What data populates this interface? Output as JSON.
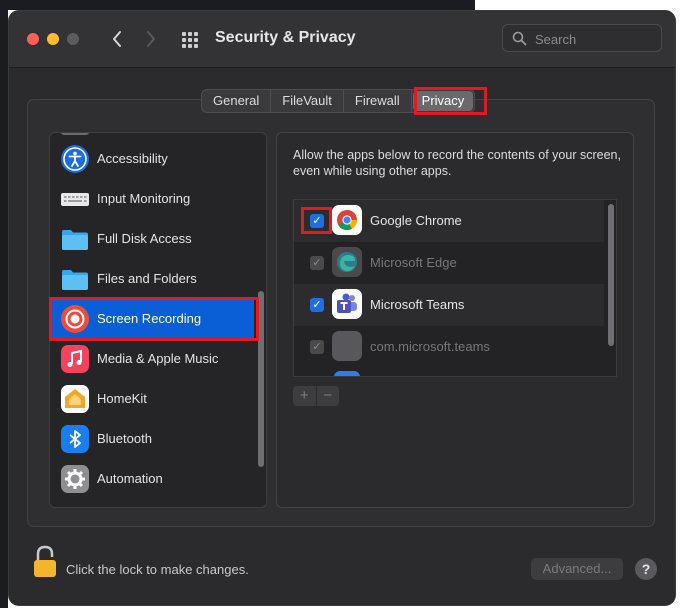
{
  "window": {
    "title": "Security & Privacy",
    "search_placeholder": "Search"
  },
  "tabs": [
    {
      "label": "General"
    },
    {
      "label": "FileVault"
    },
    {
      "label": "Firewall"
    },
    {
      "label": "Privacy",
      "active": true
    }
  ],
  "sidebar": {
    "items": [
      {
        "label": "Accessibility",
        "icon": "accessibility-icon"
      },
      {
        "label": "Input Monitoring",
        "icon": "keyboard-icon"
      },
      {
        "label": "Full Disk Access",
        "icon": "folder-icon"
      },
      {
        "label": "Files and Folders",
        "icon": "folder-icon"
      },
      {
        "label": "Screen Recording",
        "icon": "screen-recording-icon",
        "selected": true
      },
      {
        "label": "Media & Apple Music",
        "icon": "music-icon"
      },
      {
        "label": "HomeKit",
        "icon": "homekit-icon"
      },
      {
        "label": "Bluetooth",
        "icon": "bluetooth-icon"
      },
      {
        "label": "Automation",
        "icon": "gear-icon"
      }
    ]
  },
  "main": {
    "description": "Allow the apps below to record the contents of your screen, even while using other apps.",
    "apps": [
      {
        "name": "Google Chrome",
        "checked": true,
        "enabled": true,
        "icon": "chrome-icon"
      },
      {
        "name": "Microsoft Edge",
        "checked": true,
        "enabled": false,
        "icon": "edge-icon"
      },
      {
        "name": "Microsoft Teams",
        "checked": true,
        "enabled": true,
        "icon": "teams-icon"
      },
      {
        "name": "com.microsoft.teams",
        "checked": true,
        "enabled": false,
        "icon": "generic-app-icon"
      }
    ],
    "add_label": "+",
    "remove_label": "−"
  },
  "footer": {
    "lock_text": "Click the lock to make changes.",
    "advanced_label": "Advanced...",
    "help_label": "?"
  },
  "colors": {
    "highlight": "#e01b24",
    "selection": "#0a5fd6",
    "checkbox": "#1f6fe0"
  }
}
